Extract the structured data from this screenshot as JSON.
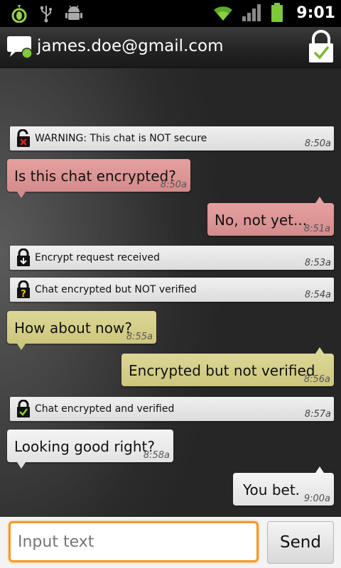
{
  "status_bar": {
    "time": "9:01",
    "icons": [
      "orbot-icon",
      "usb-icon",
      "android-debug-icon",
      "wifi-icon",
      "signal-icon",
      "battery-icon"
    ]
  },
  "header": {
    "contact": "james.doe@gmail.com"
  },
  "messages": [
    {
      "kind": "system",
      "text": "WARNING: This chat is NOT secure",
      "time": "8:50a",
      "icon": "unlocked-warning-icon"
    },
    {
      "kind": "bubble",
      "direction": "in",
      "color": "pink",
      "text": "Is this chat encrypted?",
      "time": "8:50a"
    },
    {
      "kind": "bubble",
      "direction": "out",
      "color": "pink",
      "text": "No, not yet...",
      "time": "8:51a"
    },
    {
      "kind": "system",
      "text": "Encrypt request received",
      "time": "8:53a",
      "icon": "lock-download-icon"
    },
    {
      "kind": "system",
      "text": "Chat encrypted but NOT verified",
      "time": "8:54a",
      "icon": "lock-question-icon"
    },
    {
      "kind": "bubble",
      "direction": "in",
      "color": "yellow",
      "text": "How about now?",
      "time": "8:55a"
    },
    {
      "kind": "bubble",
      "direction": "out",
      "color": "yellow",
      "text": "Encrypted but not verified",
      "time": "8:56a"
    },
    {
      "kind": "system",
      "text": "Chat encrypted and verified",
      "time": "8:57a",
      "icon": "lock-check-icon"
    },
    {
      "kind": "bubble",
      "direction": "in",
      "color": "white",
      "text": "Looking good right?",
      "time": "8:58a"
    },
    {
      "kind": "bubble",
      "direction": "out",
      "color": "white",
      "text": "You bet.",
      "time": "9:00a"
    }
  ],
  "composer": {
    "placeholder": "Input text",
    "send_label": "Send"
  },
  "colors": {
    "pink_bubble": "#dd9494",
    "yellow_bubble": "#d4ce89",
    "white_bubble": "#ececec",
    "input_focus": "#f39a2b",
    "lock_check": "#7cb82f"
  }
}
